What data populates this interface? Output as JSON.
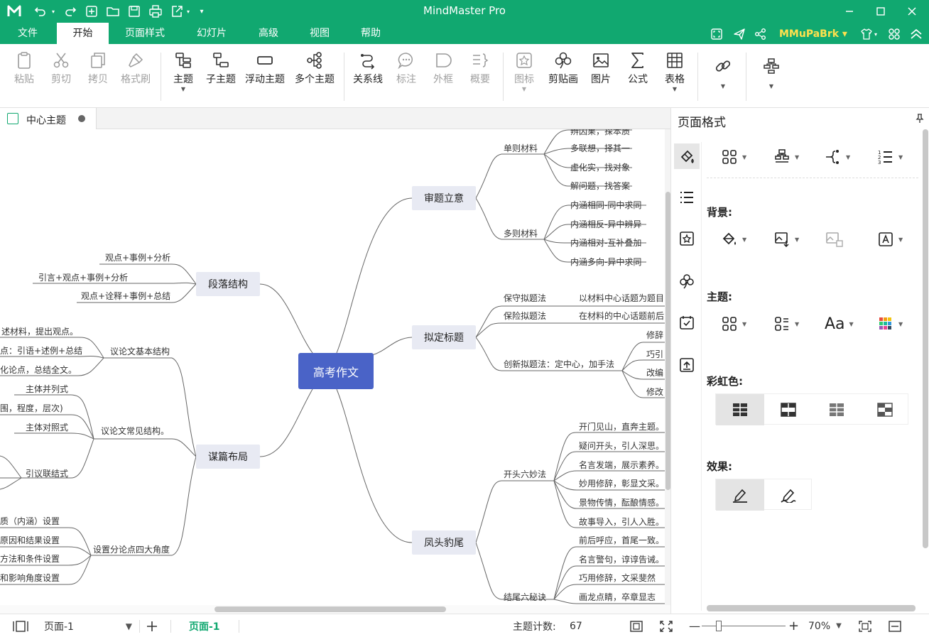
{
  "app": {
    "title": "MindMaster Pro",
    "brand_color": "#11a870",
    "user": "MMuPaBrk"
  },
  "menu_tabs": [
    "文件",
    "开始",
    "页面样式",
    "幻灯片",
    "高级",
    "视图",
    "帮助"
  ],
  "active_tab": "开始",
  "ribbon": {
    "paste": "粘贴",
    "cut": "剪切",
    "copy": "拷贝",
    "format_painter": "格式刷",
    "topic": "主题",
    "subtopic": "子主题",
    "floating_topic": "浮动主题",
    "multiple_topics": "多个主题",
    "relationship": "关系线",
    "callout": "标注",
    "boundary": "外框",
    "summary": "概要",
    "icon": "图标",
    "clipart": "剪贴画",
    "picture": "图片",
    "formula": "公式",
    "table": "表格"
  },
  "document_tab": "中心主题",
  "mindmap": {
    "central": "高考作文",
    "branches": {
      "shenti": "审题立意",
      "niding": "拟定标题",
      "fengtou": "凤头豹尾",
      "duanluo": "段落结构",
      "moupian": "谋篇布局"
    },
    "shenti_sub": {
      "single": "单则材料",
      "multi": "多则材料",
      "single_items": [
        "辨因果，探本质",
        "多联想，择其一",
        "虚化实，找对象",
        "解问题，找答案"
      ],
      "multi_items": [
        "内涵相同-同中求同",
        "内涵相反-异中辨异",
        "内涵相对-互补叠加",
        "内涵多向-异中求同"
      ]
    },
    "niding_sub": {
      "conservative": "保守拟题法",
      "conservative_desc": "以材料中心话题为题目",
      "insurance": "保险拟题法",
      "insurance_desc": "在材料的中心话题前后",
      "creative": "创新拟题法：定中心，加手法",
      "creative_items": [
        "修辞",
        "巧引",
        "改编",
        "修改"
      ]
    },
    "fengtou_sub": {
      "opening": "开头六妙法",
      "opening_items": [
        "开门见山，直奔主题。",
        "疑问开头，引人深思。",
        "名言发端，展示素养。",
        "妙用修辞，彰显文采。",
        "景物传情，酝酿情感。",
        "故事导入，引人入胜。"
      ],
      "ending": "结尾六秘诀",
      "ending_items": [
        "前后呼应，首尾一致。",
        "名言警句，谆谆告诫。",
        "巧用修辞，文采斐然",
        "画龙点睛，卒章显志"
      ]
    },
    "duanluo_items": [
      "观点+事例+分析",
      "引言+观点+事例+分析",
      "观点+诠释+事例+总结"
    ],
    "moupian_sub": {
      "basic": "议论文基本结构",
      "basic_items": [
        "述材料，提出观点。",
        "点：引语+述例+总结",
        "化论点，总结全文。"
      ],
      "common": "议论文常见结构。",
      "common_items": [
        "主体并列式",
        "围，程度，层次)",
        "主体对照式",
        "引议联结式"
      ],
      "angles": "设置分论点四大角度",
      "angle_items": [
        "质（内涵）设置",
        "原因和结果设置",
        "方法和条件设置",
        "和影响角度设置"
      ]
    }
  },
  "panel": {
    "title": "页面格式",
    "background_label": "背景:",
    "theme_label": "主题:",
    "rainbow_label": "彩虹色:",
    "effects_label": "效果:"
  },
  "status": {
    "page_select": "页面-1",
    "page_tab": "页面-1",
    "topic_count_label": "主题计数:",
    "topic_count": "67",
    "zoom": "70%"
  }
}
